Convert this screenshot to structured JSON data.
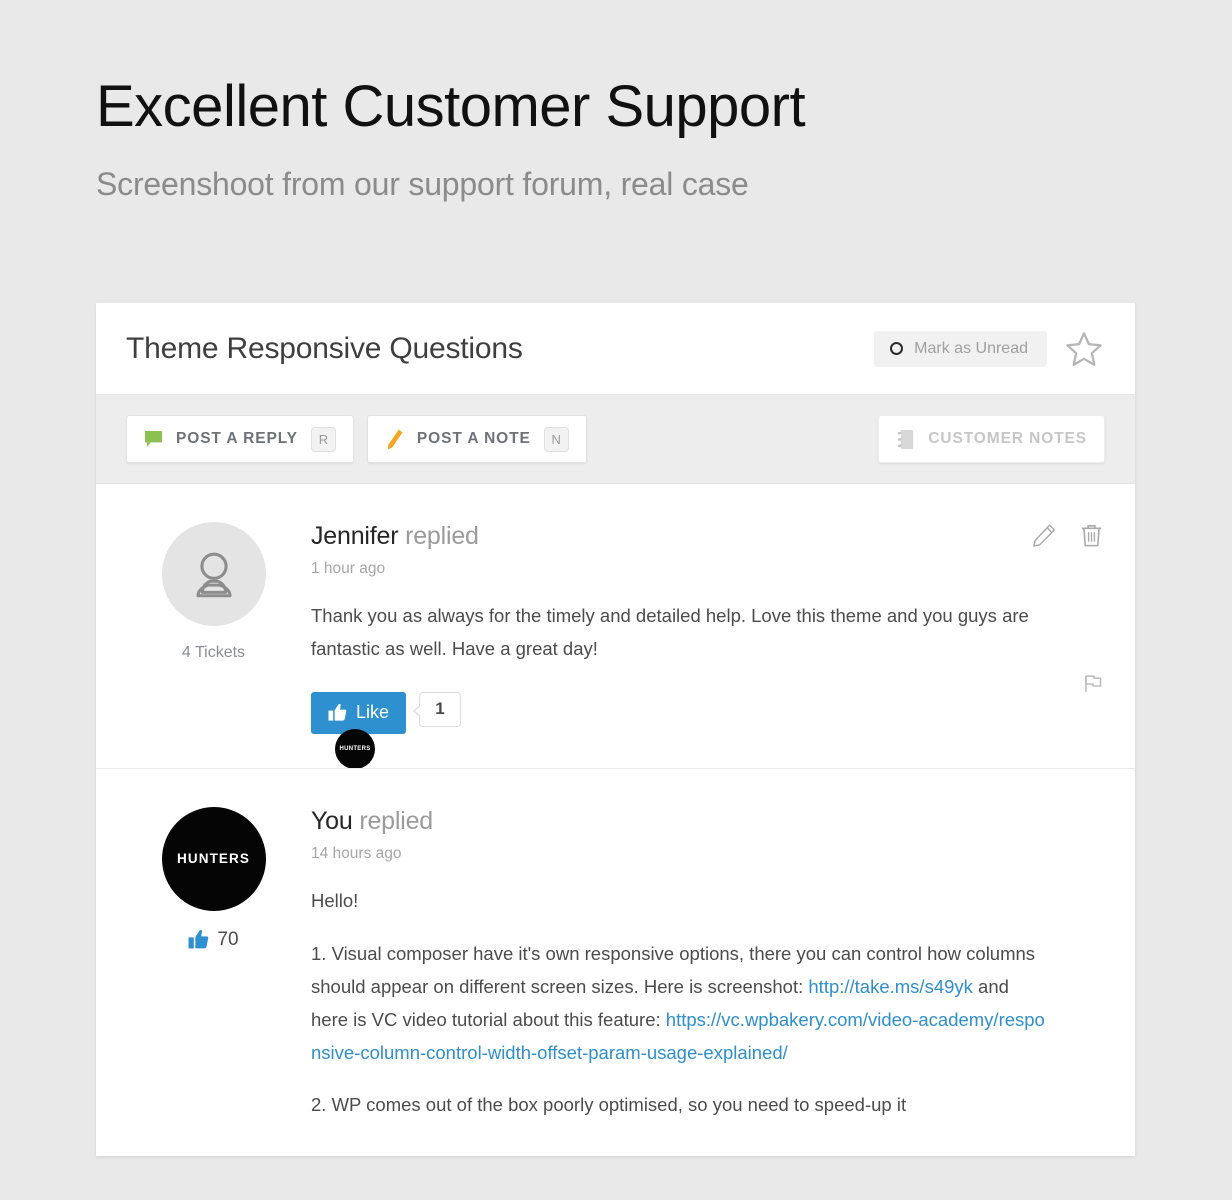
{
  "header": {
    "title": "Excellent Customer Support",
    "subtitle": "Screenshoot from our support forum, real case"
  },
  "ticket": {
    "subject": "Theme Responsive Questions",
    "mark_unread_label": "Mark as Unread",
    "star_icon": "star-icon",
    "unread_icon": "circle-ring-icon"
  },
  "toolbar": {
    "post_reply_label": "POST A REPLY",
    "post_reply_shortcut": "R",
    "post_reply_icon": "speech-bubble-icon",
    "post_note_label": "POST A NOTE",
    "post_note_shortcut": "N",
    "post_note_icon": "pencil-icon",
    "customer_notes_label": "CUSTOMER NOTES",
    "customer_notes_icon": "notebook-icon"
  },
  "posts": [
    {
      "author": "Jennifer",
      "verb": "replied",
      "time": "1 hour ago",
      "avatar_type": "placeholder",
      "avatar_icon": "user-silhouette-icon",
      "side_meta": "4 Tickets",
      "text": "Thank you as always for the timely and detailed help. Love this theme and you guys are fantastic as well. Have a great day!",
      "like_label": "Like",
      "like_count": "1",
      "liker_avatar_text": "HUNTERS",
      "edit_icon": "pencil-edit-icon",
      "delete_icon": "trash-icon",
      "flag_icon": "flag-icon"
    },
    {
      "author": "You",
      "verb": "replied",
      "time": "14 hours ago",
      "avatar_type": "brand",
      "avatar_text": "HUNTERS",
      "likes_count": "70",
      "likes_icon": "thumbs-up-icon",
      "greeting": "Hello!",
      "paragraph1_part1": "1. Visual composer have it's own responsive options, there you can control how columns should appear on different screen sizes. Here is screenshot: ",
      "link1": "http://take.ms/s49yk",
      "paragraph1_part2": " and here is VC video tutorial about this feature: ",
      "link2": "https://vc.wpbakery.com/video-academy/responsive-column-control-width-offset-param-usage-explained/",
      "paragraph2": "2. WP comes out of the box poorly optimised, so you need to speed-up it"
    }
  ],
  "colors": {
    "page_bg": "#e9e9e9",
    "accent_blue": "#2f90cf",
    "reply_green": "#8cc152",
    "note_orange": "#f5a623",
    "link_blue": "#2f8fcf"
  }
}
